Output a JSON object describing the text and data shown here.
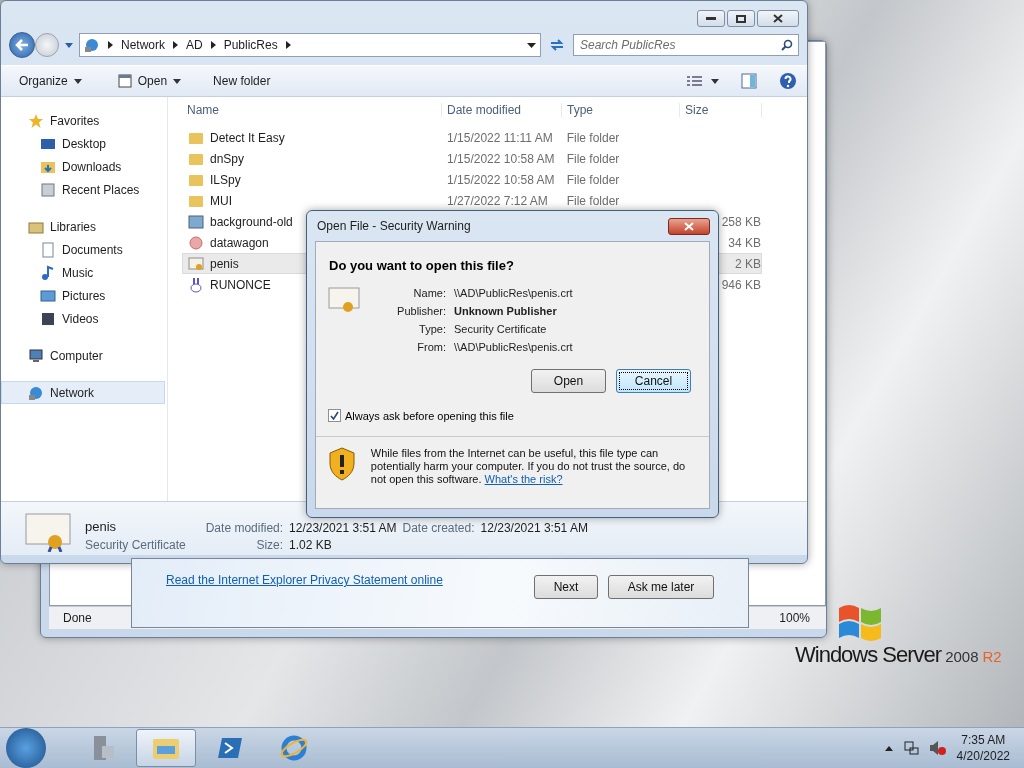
{
  "ie_window": {
    "status": "Done",
    "zoom": "100%",
    "welcome": {
      "link": "Read the Internet Explorer Privacy Statement online",
      "buttons": [
        "Next",
        "Ask me later"
      ]
    }
  },
  "explorer": {
    "address": [
      "Network",
      "AD",
      "PublicRes"
    ],
    "search": {
      "placeholder": "Search PublicRes"
    },
    "toolbar": [
      {
        "label": "Organize",
        "kind": "menu"
      },
      {
        "label": "Open",
        "kind": "open"
      },
      {
        "label": "New folder",
        "kind": "plain"
      }
    ],
    "nav": [
      {
        "label": "Favorites",
        "kind": "star",
        "selected": false,
        "children": [
          {
            "label": "Desktop",
            "kind": "desktop",
            "selected": false
          },
          {
            "label": "Downloads",
            "kind": "downloads",
            "selected": false
          },
          {
            "label": "Recent Places",
            "kind": "recent",
            "selected": false
          }
        ]
      },
      {
        "label": "Libraries",
        "kind": "library",
        "selected": false,
        "children": [
          {
            "label": "Documents",
            "kind": "document",
            "selected": false
          },
          {
            "label": "Music",
            "kind": "music",
            "selected": false
          },
          {
            "label": "Pictures",
            "kind": "picture",
            "selected": false
          },
          {
            "label": "Videos",
            "kind": "video",
            "selected": false
          }
        ]
      },
      {
        "label": "Computer",
        "kind": "computer",
        "selected": false
      },
      {
        "label": "Network",
        "kind": "network",
        "selected": true
      }
    ],
    "columns": [
      "Name",
      "Date modified",
      "Type",
      "Size"
    ],
    "rows": [
      {
        "name": "Detect It Easy",
        "kind": "folder",
        "date": "1/15/2022 11:11 AM",
        "type": "File folder",
        "selected": false
      },
      {
        "name": "dnSpy",
        "kind": "folder",
        "date": "1/15/2022 10:58 AM",
        "type": "File folder",
        "selected": false
      },
      {
        "name": "ILSpy",
        "kind": "folder",
        "date": "1/15/2022 10:58 AM",
        "type": "File folder",
        "selected": false
      },
      {
        "name": "MUI",
        "kind": "folder",
        "date": "1/27/2022 7:12 AM",
        "type": "File folder",
        "selected": false
      },
      {
        "name": "background-old",
        "kind": "image",
        "size": "258 KB",
        "selected": false
      },
      {
        "name": "datawagon",
        "kind": "app",
        "size": "34 KB",
        "selected": false
      },
      {
        "name": "penis",
        "kind": "certificate",
        "size": "2 KB",
        "selected": true
      },
      {
        "name": "RUNONCE",
        "kind": "rabbit",
        "size": "946 KB",
        "selected": false
      }
    ],
    "details": {
      "name": "penis",
      "type": "Security Certificate",
      "fields": [
        {
          "label": "Date modified:",
          "value": "12/23/2021 3:51 AM"
        },
        {
          "label": "Date created:",
          "value": "12/23/2021 3:51 AM"
        },
        {
          "label": "Size:",
          "value": "1.02 KB"
        }
      ]
    }
  },
  "dialog": {
    "title": "Open File - Security Warning",
    "heading": "Do you want to open this file?",
    "fields": [
      {
        "label": "Name:",
        "value": "\\\\AD\\PublicRes\\penis.crt",
        "kind": "plain"
      },
      {
        "label": "Publisher:",
        "value": "Unknown Publisher",
        "kind": "strong"
      },
      {
        "label": "Type:",
        "value": "Security Certificate",
        "kind": "plain"
      },
      {
        "label": "From:",
        "value": "\\\\AD\\PublicRes\\penis.crt",
        "kind": "plain"
      }
    ],
    "buttons": [
      {
        "label": "Open",
        "selected": false
      },
      {
        "label": "Cancel",
        "selected": true
      }
    ],
    "checkbox": {
      "label": "Always ask before opening this file",
      "checked": true
    },
    "warning": {
      "text": "While files from the Internet can be useful, this file type can potentially harm your computer. If you do not trust the source, do not open this software.",
      "link": "What's the risk?"
    }
  },
  "logo": {
    "brand": "Windows Server",
    "version": "2008",
    "edition": "R2"
  },
  "taskbar": {
    "items": [
      {
        "kind": "server",
        "selected": false
      },
      {
        "kind": "explorer",
        "selected": true
      },
      {
        "kind": "powershell",
        "selected": false
      },
      {
        "kind": "ie",
        "selected": false
      }
    ],
    "time": "7:35 AM",
    "date": "4/20/2022"
  }
}
